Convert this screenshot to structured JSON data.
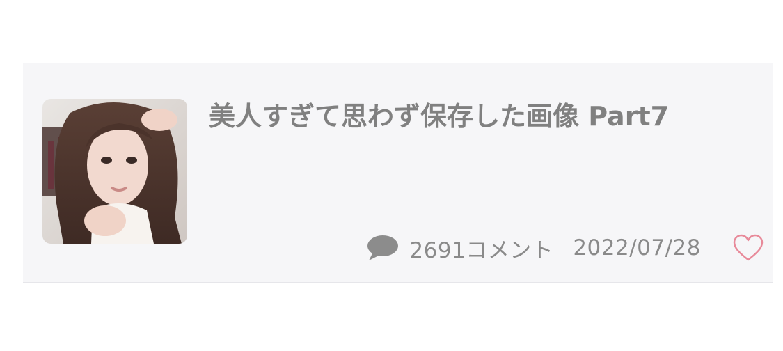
{
  "article": {
    "title": "美人すぎて思わず保存した画像 Part7",
    "comment_count": "2691コメント",
    "date": "2022/07/28",
    "thumbnail_alt": "portrait photo thumbnail"
  },
  "icons": {
    "comment": "speech-bubble-icon",
    "like": "heart-outline-icon"
  },
  "colors": {
    "card_background": "#f6f6f8",
    "title_text": "#808080",
    "meta_text": "#8a8a8a",
    "heart": "#e88a9a"
  }
}
